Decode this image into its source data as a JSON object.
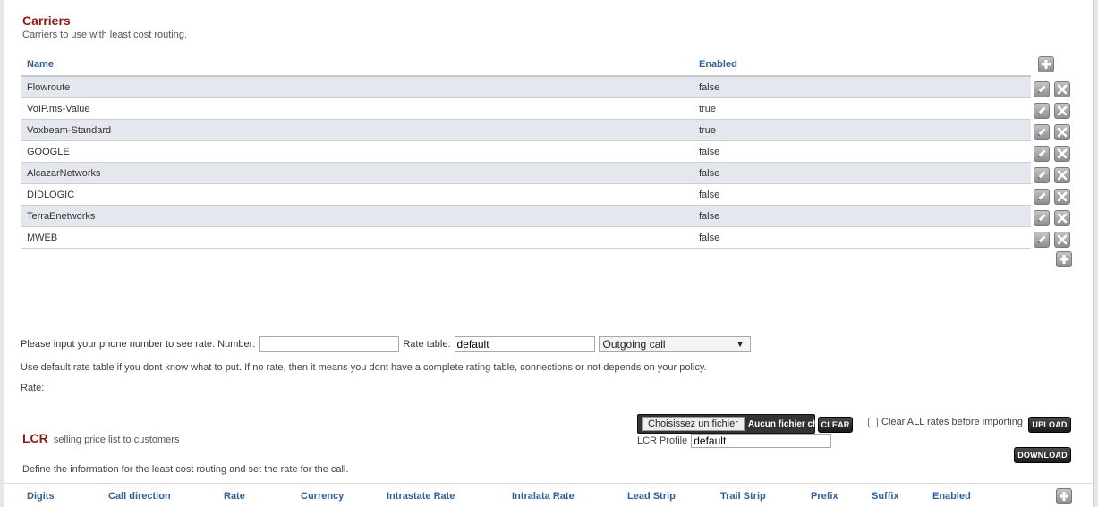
{
  "carriers": {
    "title": "Carriers",
    "subtitle": "Carriers to use with least cost routing.",
    "columns": {
      "name": "Name",
      "enabled": "Enabled"
    },
    "rows": [
      {
        "name": "Flowroute",
        "enabled": "false"
      },
      {
        "name": "VoIP.ms-Value",
        "enabled": "true"
      },
      {
        "name": "Voxbeam-Standard",
        "enabled": "true"
      },
      {
        "name": "GOOGLE",
        "enabled": "false"
      },
      {
        "name": "AlcazarNetworks",
        "enabled": "false"
      },
      {
        "name": "DIDLOGIC",
        "enabled": "false"
      },
      {
        "name": "TerraEnetworks",
        "enabled": "false"
      },
      {
        "name": "MWEB",
        "enabled": "false"
      }
    ]
  },
  "rate_lookup": {
    "prompt": "Please input your phone number to see rate: Number:",
    "number_value": "",
    "rate_table_label": "Rate table:",
    "rate_table_value": "default",
    "direction_selected": "Outgoing call",
    "note": "Use default rate table if you dont know what to put. If no rate, then it means you dont have a complete rating table, connections or not depends on your policy.",
    "rate_label": "Rate:"
  },
  "import": {
    "choose_label": "Choisissez un fichier",
    "no_file_label": "Aucun fichier choisi",
    "clear_label": "CLEAR",
    "clear_all_label": "Clear ALL rates before importing",
    "upload_label": "UPLOAD",
    "profile_label": "LCR Profile",
    "profile_value": "default",
    "download_label": "DOWNLOAD"
  },
  "lcr": {
    "title": "LCR",
    "subtitle": "selling price list to customers",
    "description": "Define the information for the least cost routing and set the rate for the call.",
    "columns": [
      "Digits",
      "Call direction",
      "Rate",
      "Currency",
      "Intrastate Rate",
      "Intralata Rate",
      "Lead Strip",
      "Trail Strip",
      "Prefix",
      "Suffix",
      "Enabled"
    ]
  },
  "icons": {
    "edit": "pencil-icon",
    "delete": "close-icon",
    "add": "plus-icon"
  },
  "colors": {
    "heading": "#8b1a1a",
    "column_header": "#2d5f9a",
    "row_stripe": "#e4e7ee"
  }
}
